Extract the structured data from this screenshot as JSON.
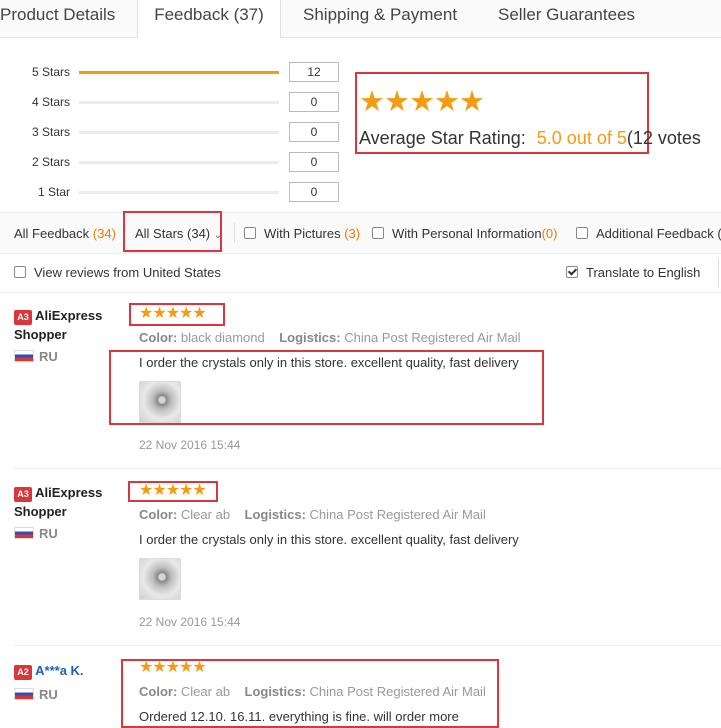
{
  "tabs": [
    {
      "label": "Product Details"
    },
    {
      "label": "Feedback (37)"
    },
    {
      "label": "Shipping & Payment"
    },
    {
      "label": "Seller Guarantees"
    }
  ],
  "histogram": [
    {
      "label": "5 Stars",
      "count": "12",
      "fill": 1.0
    },
    {
      "label": "4 Stars",
      "count": "0",
      "fill": 0
    },
    {
      "label": "3 Stars",
      "count": "0",
      "fill": 0
    },
    {
      "label": "2 Stars",
      "count": "0",
      "fill": 0
    },
    {
      "label": "1 Star",
      "count": "0",
      "fill": 0
    }
  ],
  "summary": {
    "stars": "★★★★★",
    "label": "Average Star Rating:",
    "value": "5.0 out of 5",
    "votes": "(12 votes"
  },
  "filters": {
    "all_feedback": "All Feedback",
    "all_feedback_count": "(34)",
    "all_stars": "All Stars (34)",
    "with_pictures": "With Pictures",
    "with_pictures_count": "(3)",
    "personal_info": "With Personal Information",
    "personal_info_count": "(0)",
    "additional": "Additional Feedback (",
    "view_from": "View reviews from United States",
    "translate": "Translate to English",
    "translate_checked": true
  },
  "reviews": [
    {
      "badge": "A3",
      "name_line1": "AliExpress",
      "name_line2": "Shopper",
      "country": "RU",
      "stars": "★★★★★",
      "color_label": "Color:",
      "color_value": "black diamond",
      "logistics_label": "Logistics:",
      "logistics_value": "China Post Registered Air Mail",
      "text": "I order the crystals only in this store. excellent quality, fast delivery",
      "date": "22 Nov 2016 15:44"
    },
    {
      "badge": "A3",
      "name_line1": "AliExpress",
      "name_line2": "Shopper",
      "country": "RU",
      "stars": "★★★★★",
      "color_label": "Color:",
      "color_value": "Clear ab",
      "logistics_label": "Logistics:",
      "logistics_value": "China Post Registered Air Mail",
      "text": "I order the crystals only in this store. excellent quality, fast delivery",
      "date": "22 Nov 2016 15:44"
    },
    {
      "badge": "A2",
      "name_line1": "A***a K.",
      "country": "RU",
      "stars": "★★★★★",
      "color_label": "Color:",
      "color_value": "Clear ab",
      "logistics_label": "Logistics:",
      "logistics_value": "China Post Registered Air Mail",
      "text": "Ordered 12.10. 16.11. everything is fine. will order more"
    }
  ],
  "colors": {
    "accent": "#f39c12",
    "highlight_box": "#d9373b",
    "badge": "#d9373b"
  }
}
